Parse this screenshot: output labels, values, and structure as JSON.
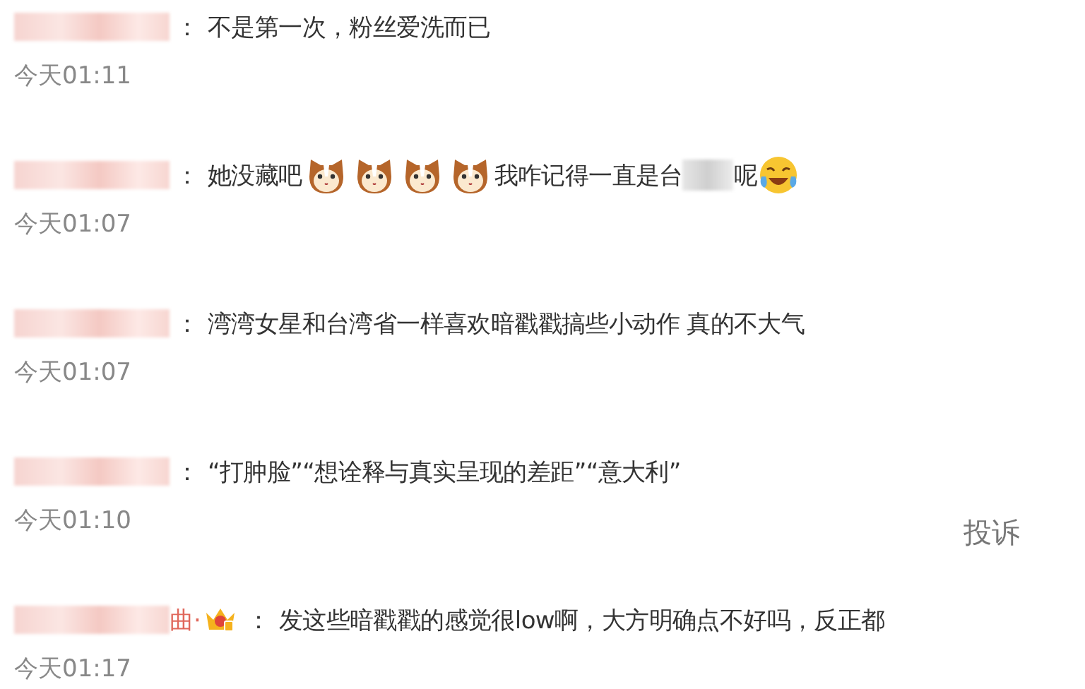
{
  "comments": [
    {
      "author": [
        {
          "kind": "blur"
        }
      ],
      "sep": "：",
      "body": [
        {
          "kind": "text",
          "text": "不是第一次，粉丝爱洗而已"
        }
      ],
      "time": "今天01:11"
    },
    {
      "author": [
        {
          "kind": "blur"
        }
      ],
      "sep": "：",
      "body": [
        {
          "kind": "text",
          "text": "她没藏吧"
        },
        {
          "kind": "cat"
        },
        {
          "kind": "cat"
        },
        {
          "kind": "cat"
        },
        {
          "kind": "cat"
        },
        {
          "kind": "text",
          "text": "我咋记得一直是台"
        },
        {
          "kind": "blur"
        },
        {
          "kind": "text",
          "text": "呢"
        },
        {
          "kind": "laugh"
        }
      ],
      "time": "今天01:07"
    },
    {
      "author": [
        {
          "kind": "blur"
        }
      ],
      "sep": "：",
      "body": [
        {
          "kind": "text",
          "text": "湾湾女星和台湾省一样喜欢暗戳戳搞些小动作 真的不大气"
        }
      ],
      "time": "今天01:07"
    },
    {
      "author": [
        {
          "kind": "blur"
        }
      ],
      "sep": "：",
      "body": [
        {
          "kind": "text",
          "text": "“打肿脸”“想诠释与真实呈现的差距”“意大利”"
        }
      ],
      "time": "今天01:10"
    },
    {
      "author": [
        {
          "kind": "blur"
        },
        {
          "kind": "text",
          "text": "曲·"
        },
        {
          "kind": "crown"
        }
      ],
      "sep": "：",
      "body": [
        {
          "kind": "text",
          "text": "发这些暗戳戳的感觉很low啊，大方明确点不好吗，反正都"
        }
      ],
      "time": "今天01:17"
    }
  ],
  "report": "投诉"
}
